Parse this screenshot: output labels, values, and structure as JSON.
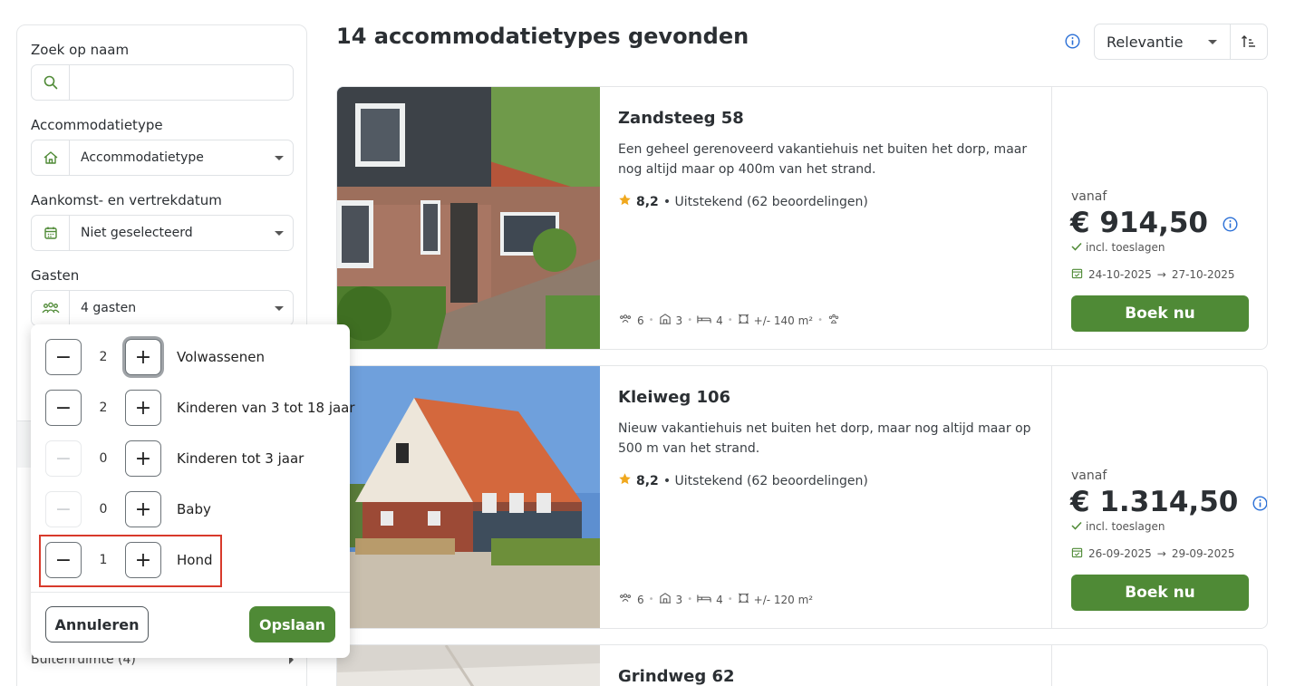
{
  "sidebar": {
    "search_label": "Zoek op naam",
    "search_value": "",
    "type_label": "Accommodatietype",
    "type_value": "Accommodatietype",
    "dates_label": "Aankomst- en vertrekdatum",
    "dates_value": "Niet geselecteerd",
    "guests_label": "Gasten",
    "guests_value": "4 gasten",
    "outdoor_label": "Buitenruimte (4)"
  },
  "guests_popup": {
    "rows": [
      {
        "count": "2",
        "label": "Volwassenen"
      },
      {
        "count": "2",
        "label": "Kinderen van 3 tot 18 jaar"
      },
      {
        "count": "0",
        "label": "Kinderen tot 3 jaar"
      },
      {
        "count": "0",
        "label": "Baby"
      },
      {
        "count": "1",
        "label": "Hond"
      }
    ],
    "minus": "−",
    "plus": "+",
    "cancel_label": "Annuleren",
    "save_label": "Opslaan"
  },
  "results": {
    "title": "14 accommodatietypes gevonden",
    "sort_value": "Relevantie"
  },
  "cards": [
    {
      "name": "Zandsteeg 58",
      "description": "Een geheel gerenoveerd vakantiehuis net buiten het dorp, maar nog altijd maar op 400m van het strand.",
      "rating": "8,2",
      "rating_text": "• Uitstekend (62 beoordelingen)",
      "persons": "6",
      "bedrooms": "3",
      "beds": "4",
      "area": "+/- 140 m²",
      "vanaf": "vanaf",
      "price": "€ 914,50",
      "incl": "incl. toeslagen",
      "date_from": "24-10-2025",
      "arrow": "→",
      "date_to": "27-10-2025",
      "book_label": "Boek nu"
    },
    {
      "name": "Kleiweg 106",
      "description": "Nieuw vakantiehuis net buiten het dorp, maar nog altijd maar op 500 m van het strand.",
      "rating": "8,2",
      "rating_text": "• Uitstekend (62 beoordelingen)",
      "persons": "6",
      "bedrooms": "3",
      "beds": "4",
      "area": "+/- 120 m²",
      "vanaf": "vanaf",
      "price": "€ 1.314,50",
      "incl": "incl. toeslagen",
      "date_from": "26-09-2025",
      "arrow": "→",
      "date_to": "29-09-2025",
      "book_label": "Boek nu"
    },
    {
      "name": "Grindweg 62"
    }
  ],
  "colors": {
    "accent_green": "#4f8a36",
    "info_blue": "#2a6fd6",
    "highlight_red": "#d83a2b"
  }
}
